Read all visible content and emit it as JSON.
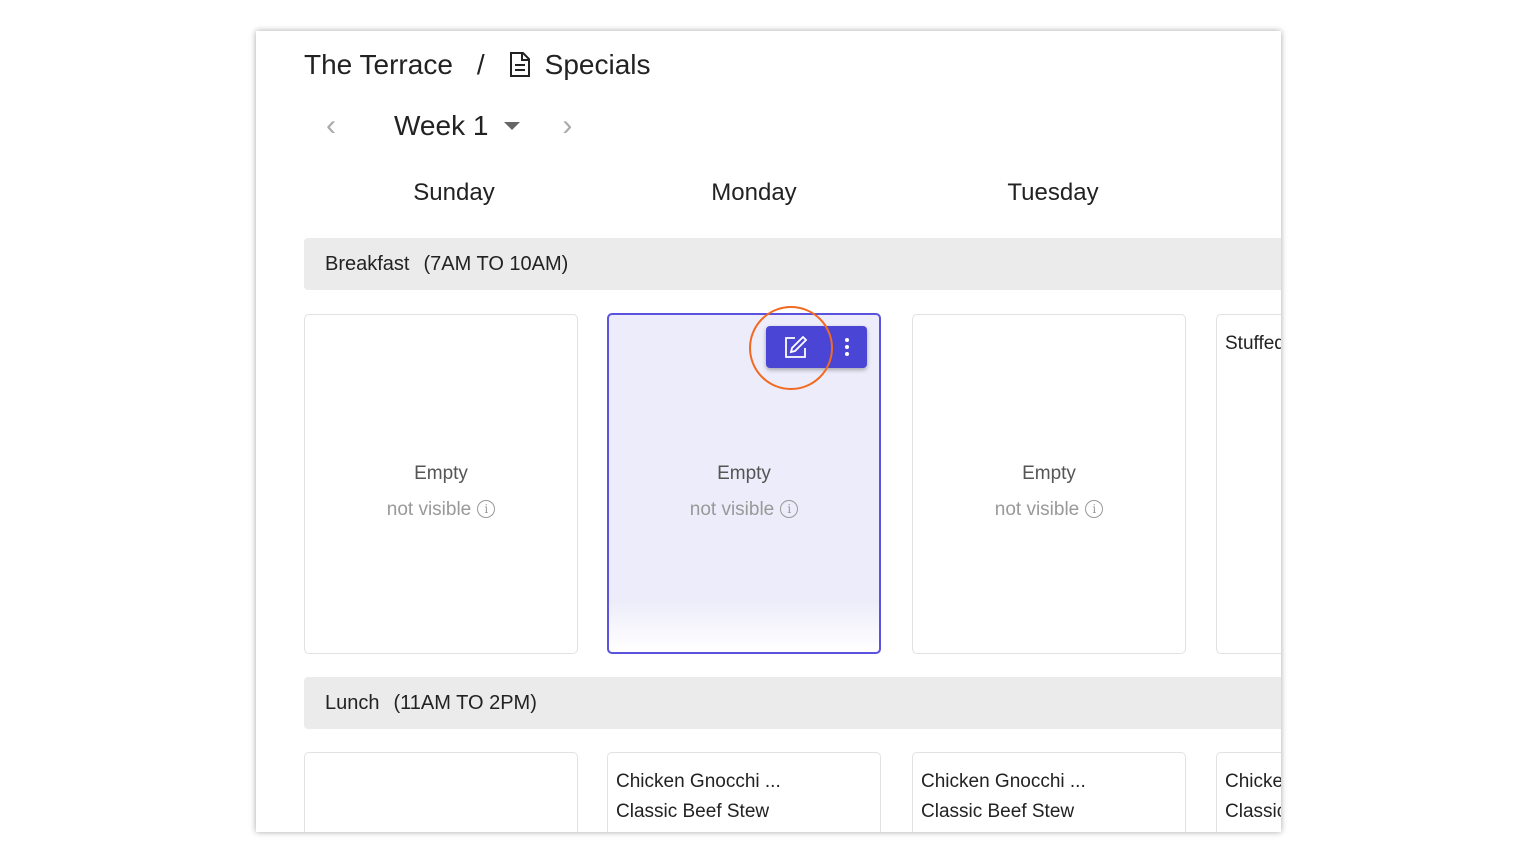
{
  "breadcrumb": {
    "parent": "The Terrace",
    "separator": "/",
    "current": "Specials",
    "current_icon": "document-icon"
  },
  "week_nav": {
    "label": "Week 1",
    "prev_icon": "chevron-left-icon",
    "next_icon": "chevron-right-icon"
  },
  "days": [
    "Sunday",
    "Monday",
    "Tuesday"
  ],
  "sections": [
    {
      "name": "Breakfast",
      "hours": "(7AM TO 10AM)",
      "cards": [
        {
          "title": "Empty",
          "status": "not visible"
        },
        {
          "title": "Empty",
          "status": "not visible",
          "selected": true
        },
        {
          "title": "Empty",
          "status": "not visible"
        },
        {
          "items": [
            "Stuffed"
          ]
        }
      ]
    },
    {
      "name": "Lunch",
      "hours": "(11AM TO 2PM)",
      "cards": [
        {
          "items": []
        },
        {
          "items": [
            "Chicken Gnocchi ...",
            "Classic Beef Stew"
          ]
        },
        {
          "items": [
            "Chicken Gnocchi ...",
            "Classic Beef Stew"
          ]
        },
        {
          "items": [
            "Chicken Gnocchi ...",
            "Classic Beef Stew"
          ]
        }
      ]
    }
  ],
  "colors": {
    "accent": "#4b45d6",
    "selected_border": "#5b52dd",
    "highlight_ring": "#f26a22"
  }
}
